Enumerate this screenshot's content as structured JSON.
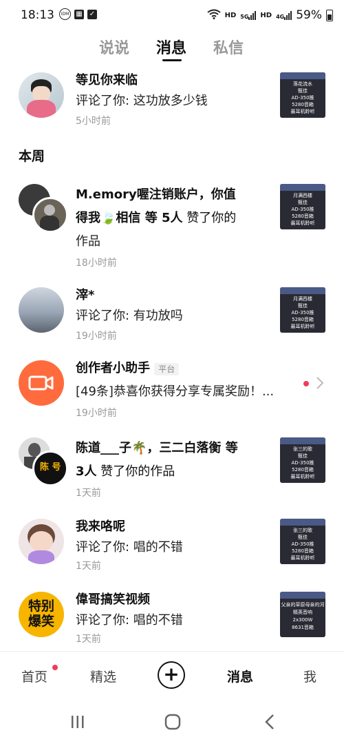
{
  "status": {
    "time": "18:13",
    "left_icons": [
      "idm-icon",
      "gallery-icon",
      "check-icon"
    ],
    "hd1": "HD",
    "net1": "5G",
    "hd2": "HD",
    "net2": "4G",
    "battery": "59%"
  },
  "tabs": [
    {
      "label": "说说"
    },
    {
      "label": "消息"
    },
    {
      "label": "私信"
    }
  ],
  "section_week": "本周",
  "items": [
    {
      "title": "等见你来临",
      "subtitle": "评论了你: 这功放多少钱",
      "time": "5小时前",
      "thumb": [
        "落花流水",
        "甄佳",
        "AD-350推",
        "5280音箱",
        "最耳机聆听"
      ]
    },
    {
      "title_l1": "M.emory喔注销账户，你值",
      "title_l2a": "得我",
      "title_l2b": "相信 等 5人",
      "title_l2c": " 赞了你的",
      "title_l3": "作品",
      "time": "18小时前",
      "thumb": [
        "月满西楼",
        "甄佳",
        "AD-350推",
        "5280音箱",
        "最耳机聆听"
      ]
    },
    {
      "title": "滓*",
      "subtitle": "评论了你: 有功放吗",
      "time": "19小时前",
      "thumb": [
        "月满西楼",
        "甄佳",
        "AD-350推",
        "5280音箱",
        "最耳机聆听"
      ]
    },
    {
      "title": "创作者小助手",
      "tag": "平台",
      "subtitle": "[49条]恭喜你获得分享专属奖励！...",
      "time": "19小时前"
    },
    {
      "title_l1": "陈道___子",
      "title_l1b": "，三二白落衡 等",
      "title_l2a": "3人",
      "title_l2b": " 赞了你的作品",
      "time": "1天前",
      "badge_text": "陈 号",
      "thumb": [
        "张三的歌",
        "甄佳",
        "AD-350推",
        "5280音箱",
        "最耳机聆听"
      ]
    },
    {
      "title": "我来咯呢",
      "subtitle": "评论了你: 唱的不错",
      "time": "1天前",
      "thumb": [
        "张三的歌",
        "甄佳",
        "AD-350推",
        "5280音箱",
        "最耳机聆听"
      ]
    },
    {
      "title": "偉哥搞笑视频",
      "subtitle": "评论了你: 唱的不错",
      "time": "1天前",
      "avatar_text": "特别\n爆笑",
      "thumb": [
        "父亲的草原母亲的河",
        "精英音响",
        "2x300W",
        "8631音箱"
      ]
    }
  ],
  "nav": [
    {
      "label": "首页"
    },
    {
      "label": "精选"
    },
    {
      "label": "消息"
    },
    {
      "label": "我"
    }
  ],
  "colors": {
    "accent_red": "#f03c5b",
    "assistant_orange": "#ff6b3d",
    "gold": "#f7b500"
  }
}
